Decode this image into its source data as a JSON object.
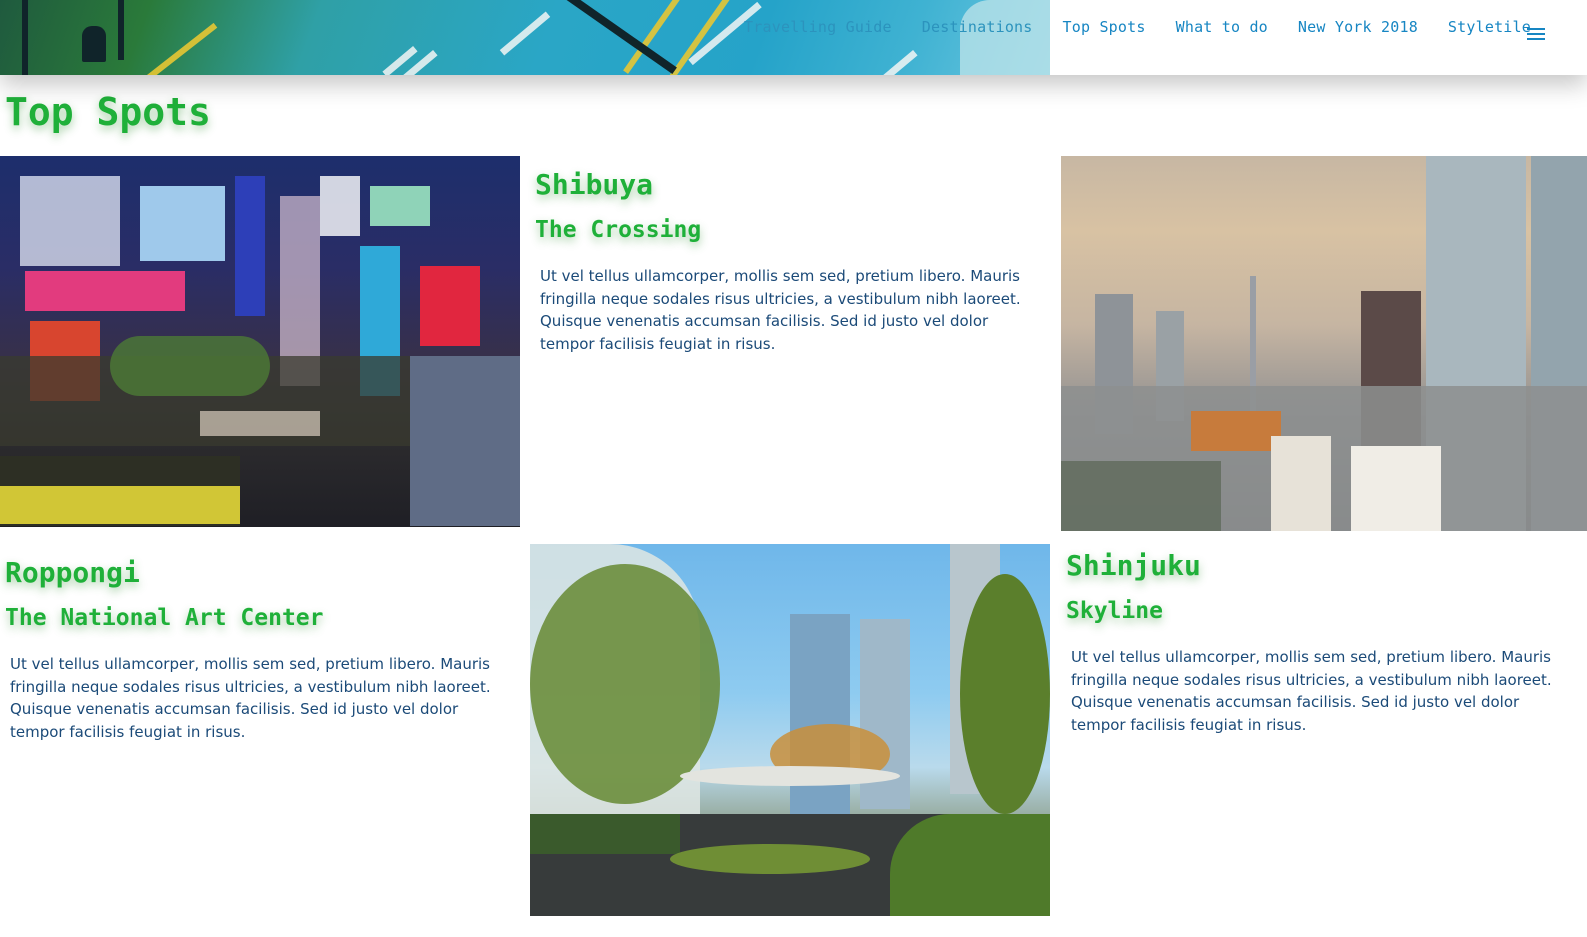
{
  "nav": {
    "links": [
      "Travelling Guide",
      "Destinations",
      "Top Spots",
      "What to do",
      "New York 2018",
      "Styletile"
    ],
    "menu_icon": "hamburger-menu-icon"
  },
  "page": {
    "title": "Top Spots"
  },
  "spots": [
    {
      "title": "Shibuya",
      "subtitle": "The Crossing",
      "text": "Ut vel tellus ullamcorper, mollis sem sed, pretium libero. Mauris fringilla neque sodales risus ultricies, a vestibulum nibh laoreet. Quisque venenatis accumsan facilisis. Sed id justo vel dolor tempor facilisis feugiat in risus."
    },
    {
      "title": "Roppongi",
      "subtitle": "The National Art Center",
      "text": "Ut vel tellus ullamcorper, mollis sem sed, pretium libero. Mauris fringilla neque sodales risus ultricies, a vestibulum nibh laoreet. Quisque venenatis accumsan facilisis. Sed id justo vel dolor tempor facilisis feugiat in risus."
    },
    {
      "title": "Shinjuku",
      "subtitle": "Skyline",
      "text": "Ut vel tellus ullamcorper, mollis sem sed, pretium libero. Mauris fringilla neque sodales risus ultricies, a vestibulum nibh laoreet. Quisque venenatis accumsan facilisis. Sed id justo vel dolor tempor facilisis feugiat in risus."
    }
  ],
  "colors": {
    "heading_green": "#1fb039",
    "nav_blue": "#1786c3",
    "body_text": "#1b4a78"
  }
}
